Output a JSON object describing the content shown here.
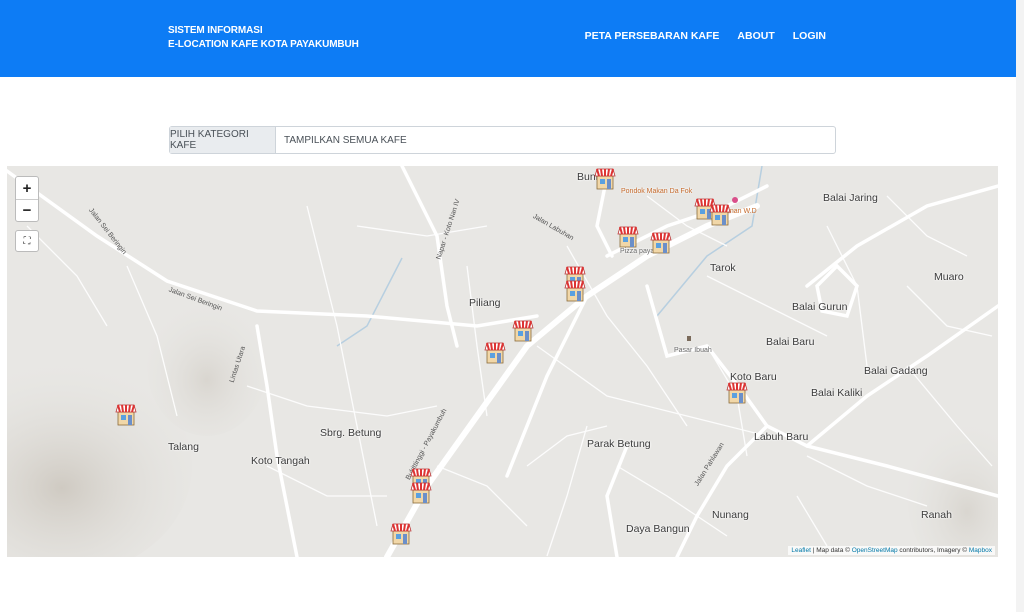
{
  "header": {
    "brand_line1": "SISTEM INFORMASI",
    "brand_line2": "E-LOCATION KAFE KOTA PAYAKUMBUH",
    "nav": [
      "PETA PERSEBARAN KAFE",
      "ABOUT",
      "LOGIN"
    ],
    "bg_color": "#0d7cf5"
  },
  "filter": {
    "label": "PILIH KATEGORI KAFE",
    "selected": "TAMPILKAN SEMUA KAFE"
  },
  "map": {
    "zoom_in": "+",
    "zoom_out": "−",
    "fullscreen_icon": "fullscreen-icon",
    "places": {
      "bunian": "Buni",
      "balai_jaring": "Balai Jaring",
      "tarok": "Tarok",
      "muaro": "Muaro",
      "piliang": "Piliang",
      "balai_gurun": "Balai Gurun",
      "balai_baru": "Balai Baru",
      "balai_gadang": "Balai Gadang",
      "koto_baru": "Koto Baru",
      "balai_kaliki": "Balai Kaliki",
      "talang": "Talang",
      "sbrg_betung": "Sbrg. Betung",
      "koto_tangah": "Koto Tangah",
      "parak_betung": "Parak Betung",
      "labuh_baru": "Labuh Baru",
      "nunang": "Nunang",
      "ranah": "Ranah",
      "daya_bangun": "Daya Bangun",
      "pasar_ibuah": "Pasar Ibuah",
      "pondok_makan": "Pondok Makan Da Fok",
      "dnan": "dnan W.D",
      "pizza": "Pizza paya      kuh"
    },
    "streets": {
      "sei_beringin_1": "Jalan Sei Beringin",
      "sei_beringin_2": "Jalan Sei Beringin",
      "napar": "Napar - Koto Nan IV",
      "lintas_utara": "Lintas Utara",
      "payakumbuh": "Bukittinggi - Payakumbuh",
      "pahlawan": "Jalan Pahlawan",
      "labuhan": "Jalan Labuhan"
    },
    "marker_icon": "cafe-shop-icon",
    "marker_count": 14,
    "attribution_leaflet": "Leaflet",
    "attribution_text": " | Map data © ",
    "attribution_osm": "OpenStreetMap",
    "attribution_mid": " contributors, Imagery © ",
    "attribution_mapbox": "Mapbox"
  }
}
